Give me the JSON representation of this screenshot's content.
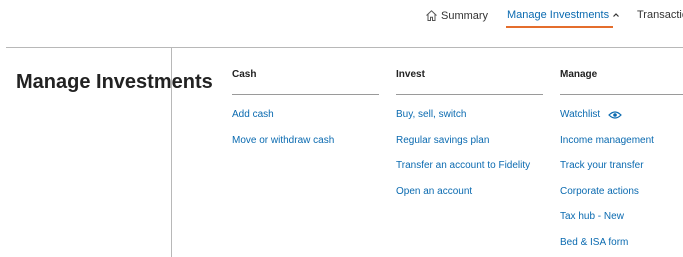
{
  "nav": {
    "summary_label": "Summary",
    "manage_label": "Manage Investments",
    "transactions_label": "Transactio",
    "accent_color": "#e46d2c"
  },
  "panel": {
    "title": "Manage Investments"
  },
  "columns": {
    "cash": {
      "heading": "Cash",
      "links": [
        "Add cash",
        "Move or withdraw cash"
      ]
    },
    "invest": {
      "heading": "Invest",
      "links": [
        "Buy, sell, switch",
        "Regular savings plan",
        "Transfer an account to Fidelity",
        "Open an account"
      ]
    },
    "manage": {
      "heading": "Manage",
      "links": [
        "Watchlist",
        "Income management",
        "Track your transfer",
        "Corporate actions",
        "Tax hub - New",
        "Bed & ISA form"
      ]
    }
  },
  "icons": {
    "summary": "home-icon",
    "manage_chevron": "chevron-up-icon",
    "watchlist": "eye-icon"
  },
  "link_color": "#0a6ab0"
}
